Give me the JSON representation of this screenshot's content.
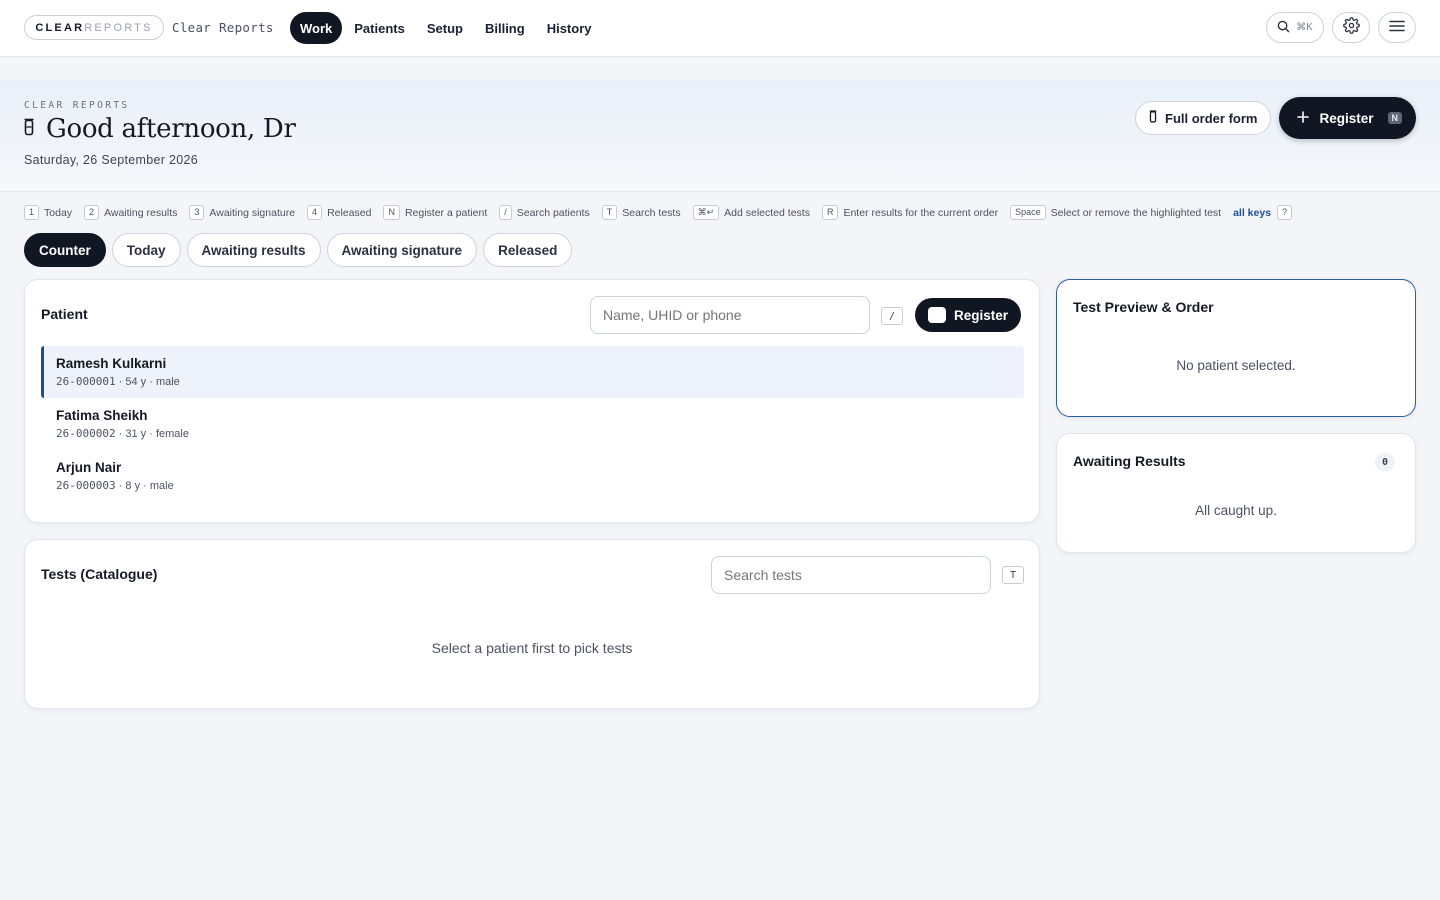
{
  "header": {
    "logo_part1": "CLEAR",
    "logo_part2": "REPORTS",
    "app_name": "Clear Reports",
    "nav": [
      {
        "label": "Work",
        "active": true
      },
      {
        "label": "Patients",
        "active": false
      },
      {
        "label": "Setup",
        "active": false
      },
      {
        "label": "Billing",
        "active": false
      },
      {
        "label": "History",
        "active": false
      }
    ],
    "command_shortcut": "⌘K",
    "icons": [
      "search-icon",
      "gear-icon",
      "menu-icon"
    ]
  },
  "hero": {
    "eyebrow": "CLEAR REPORTS",
    "greeting": "Good afternoon, Dr",
    "date": "Saturday, 26 September 2026",
    "full_order_label": "Full order form",
    "register_label": "Register",
    "register_key": "N"
  },
  "shortcuts": [
    {
      "key": "1",
      "label": "Today"
    },
    {
      "key": "2",
      "label": "Awaiting results"
    },
    {
      "key": "3",
      "label": "Awaiting signature"
    },
    {
      "key": "4",
      "label": "Released"
    },
    {
      "key": "N",
      "label": "Register a patient"
    },
    {
      "key": "/",
      "label": "Search patients"
    },
    {
      "key": "T",
      "label": "Search tests"
    },
    {
      "key": "⌘↵",
      "label": "Add selected tests"
    },
    {
      "key": "R",
      "label": "Enter results for the current order"
    },
    {
      "key": "Space",
      "label": "Select or remove the highlighted test"
    }
  ],
  "shortcuts_all": {
    "label": "all keys",
    "key": "?"
  },
  "tabs": [
    {
      "label": "Counter",
      "active": true
    },
    {
      "label": "Today",
      "active": false
    },
    {
      "label": "Awaiting results",
      "active": false
    },
    {
      "label": "Awaiting signature",
      "active": false
    },
    {
      "label": "Released",
      "active": false
    }
  ],
  "patient_panel": {
    "title": "Patient",
    "search_placeholder": "Name, UHID or phone",
    "search_key": "/",
    "register_label": "Register",
    "patients": [
      {
        "name": "Ramesh Kulkarni",
        "uhid": "26-000001",
        "details": "· 54 y · male",
        "selected": true
      },
      {
        "name": "Fatima Sheikh",
        "uhid": "26-000002",
        "details": "· 31 y · female",
        "selected": false
      },
      {
        "name": "Arjun Nair",
        "uhid": "26-000003",
        "details": "· 8 y · male",
        "selected": false
      }
    ]
  },
  "tests_panel": {
    "title": "Tests (Catalogue)",
    "search_placeholder": "Search tests",
    "search_key": "T",
    "empty_message": "Select a patient first to pick tests"
  },
  "preview_panel": {
    "title": "Test Preview & Order",
    "empty_message": "No patient selected."
  },
  "awaiting_panel": {
    "title": "Awaiting Results",
    "count": "0",
    "empty_message": "All caught up."
  }
}
